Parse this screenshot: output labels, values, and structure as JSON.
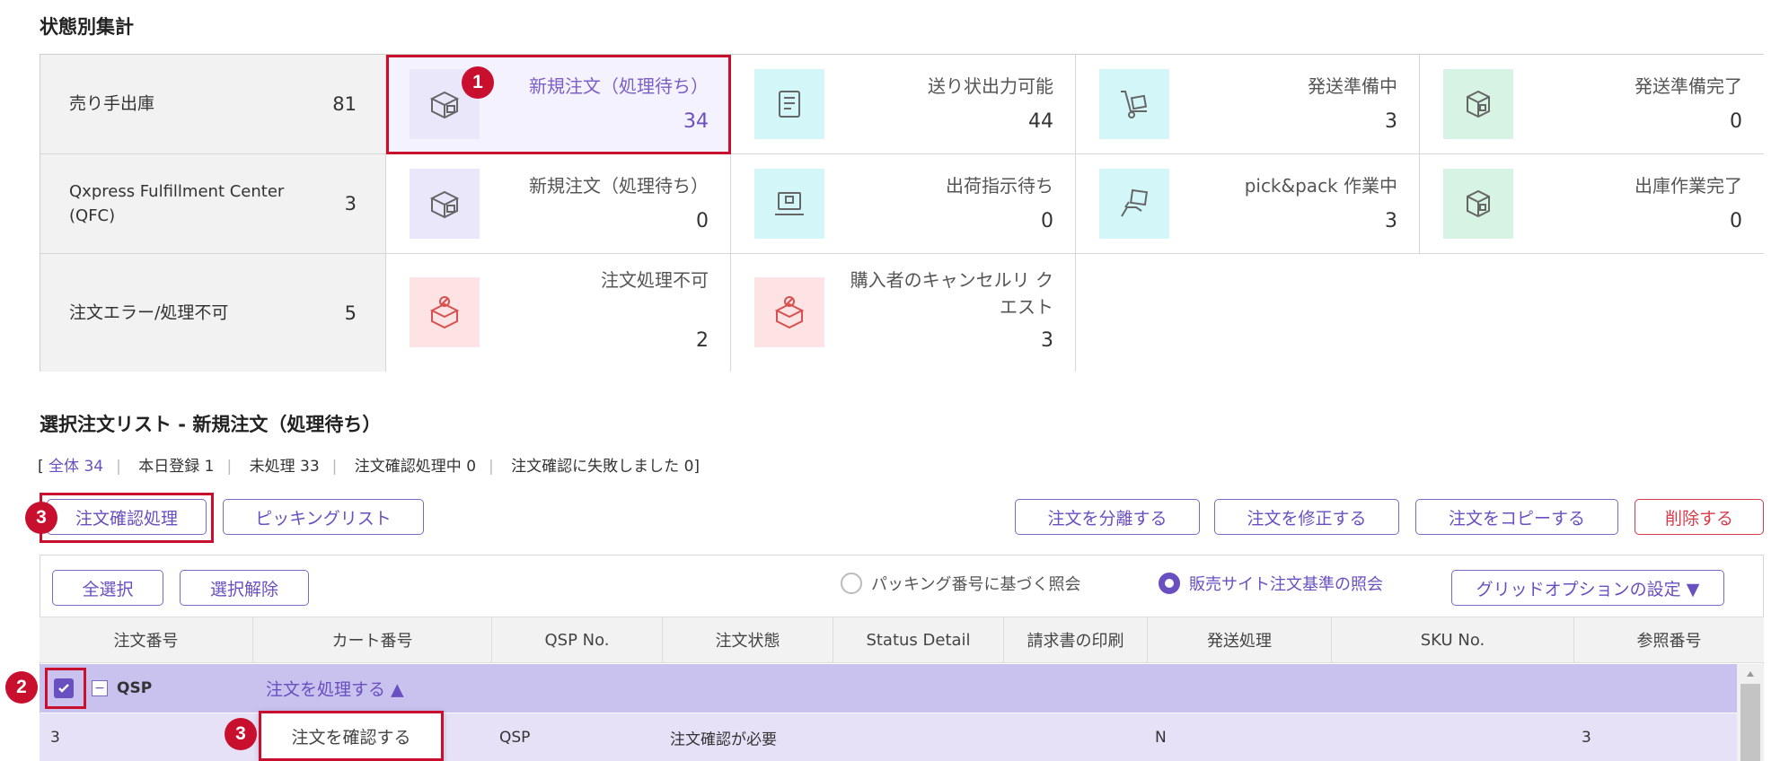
{
  "summary": {
    "title": "状態別集計",
    "rows": [
      {
        "label": "売り手出庫",
        "count": "81",
        "cells": [
          {
            "icon": "box-icon",
            "label": "新規注文（処理待ち）",
            "value": "34"
          },
          {
            "icon": "document-icon",
            "label": "送り状出力可能",
            "value": "44"
          },
          {
            "icon": "hand-truck-icon",
            "label": "発送準備中",
            "value": "3"
          },
          {
            "icon": "package-icon",
            "label": "発送準備完了",
            "value": "0"
          }
        ]
      },
      {
        "label": "Qxpress Fulfillment Center (QFC)",
        "count": "3",
        "cells": [
          {
            "icon": "box-icon",
            "label": "新規注文（処理待ち）",
            "value": "0"
          },
          {
            "icon": "monitor-icon",
            "label": "出荷指示待ち",
            "value": "0"
          },
          {
            "icon": "pick-pack-icon",
            "label": "pick&pack 作業中",
            "value": "3"
          },
          {
            "icon": "package-icon",
            "label": "出庫作業完了",
            "value": "0"
          }
        ]
      },
      {
        "label": "注文エラー/処理不可",
        "count": "5",
        "cells": [
          {
            "icon": "error-box-icon",
            "label": "注文処理不可",
            "value": "2"
          },
          {
            "icon": "cancel-box-icon",
            "label": "購入者のキャンセルリ クエスト",
            "value": "3"
          }
        ]
      }
    ]
  },
  "list": {
    "title": "選択注文リスト - 新規注文（処理待ち）",
    "filter_open": "[",
    "filter_close": "]",
    "filters": [
      "全体 34",
      "本日登録 1",
      "未処理 33",
      "注文確認処理中 0",
      "注文確認に失敗しました 0"
    ]
  },
  "toolbar": {
    "confirm_label": "注文確認処理",
    "picking_label": "ピッキングリスト",
    "split_label": "注文を分離する",
    "modify_label": "注文を修正する",
    "copy_label": "注文をコピーする",
    "delete_label": "削除する",
    "select_all_label": "全選択",
    "deselect_label": "選択解除",
    "radio_packing_label": "パッキング番号に基づく照会",
    "radio_site_label": "販売サイト注文基準の照会",
    "grid_option_label": "グリッドオプションの設定 ▼"
  },
  "table": {
    "headers": [
      "注文番号",
      "カート番号",
      "QSP No.",
      "注文状態",
      "Status Detail",
      "請求書の印刷",
      "発送処理",
      "SKU No.",
      "参照番号"
    ],
    "group_label": "QSP",
    "group_action": "注文を処理する ▲",
    "row": {
      "order_no": "3",
      "qsp_no": "QSP",
      "status": "注文確認が必要",
      "shipping": "N",
      "ref_no": "3"
    },
    "dropdown_item": "注文を確認する"
  },
  "badges": {
    "one": "1",
    "two": "2",
    "three": "3"
  },
  "colors": {
    "accent": "#6a4fc0",
    "highlight_border": "#c8102e",
    "group_row": "#c9c1ee",
    "data_row": "#e6e1f7"
  }
}
